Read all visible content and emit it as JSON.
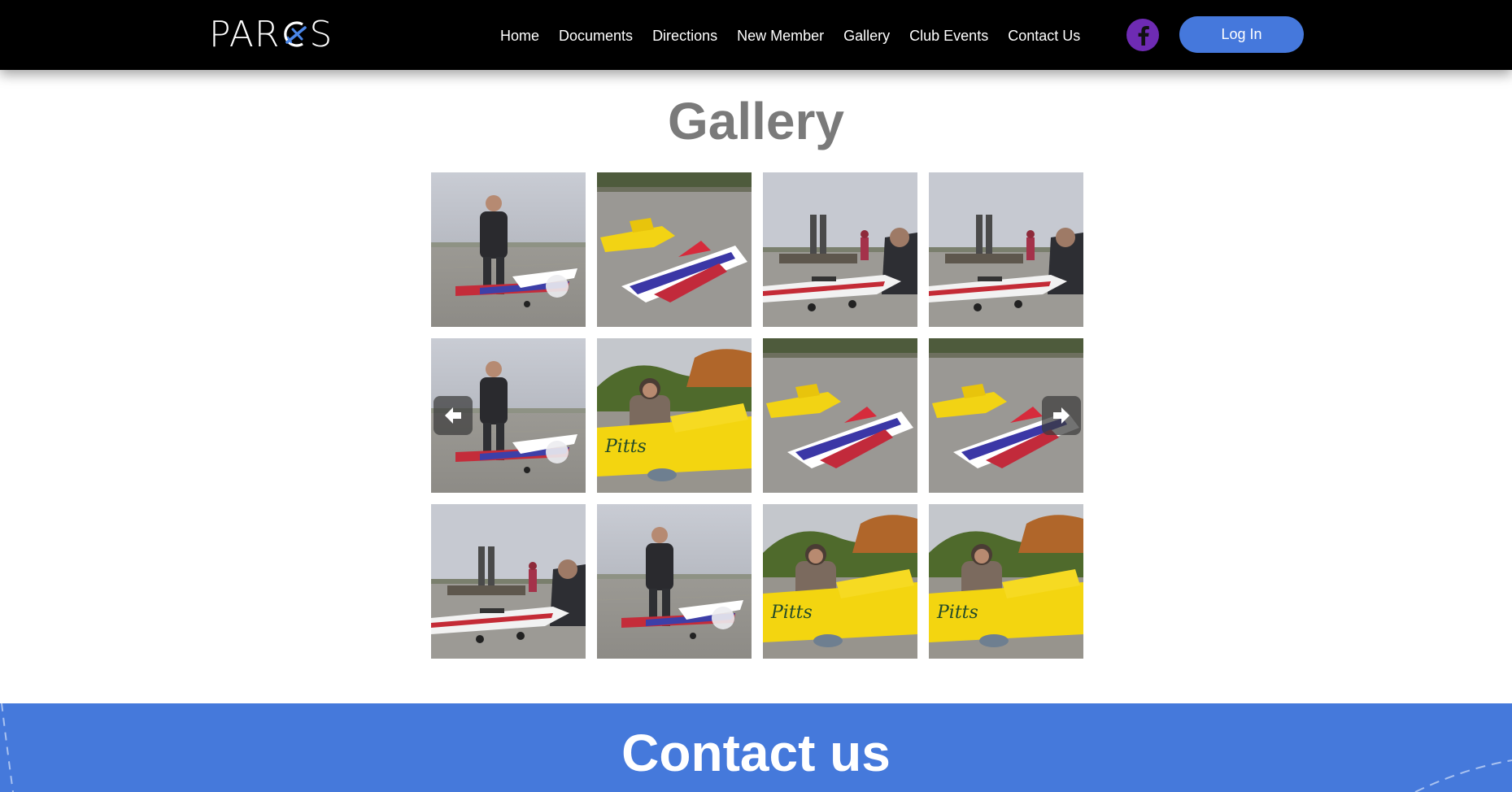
{
  "header": {
    "logo_text_left": "PAR",
    "logo_text_right": "S",
    "nav": [
      "Home",
      "Documents",
      "Directions",
      "New Member",
      "Gallery",
      "Club Events",
      "Contact Us"
    ],
    "social_icon": "facebook-icon",
    "login_label": "Log In"
  },
  "gallery": {
    "title": "Gallery",
    "prev_icon": "arrow-left-icon",
    "next_icon": "arrow-right-icon",
    "rows": 3,
    "columns": 4,
    "images": [
      "man-standing-with-plane",
      "yellow-and-striped-planes",
      "man-with-white-plane-at-tables",
      "man-with-white-plane-at-tables",
      "man-standing-with-plane",
      "man-kneeling-with-yellow-pitts",
      "yellow-and-striped-planes",
      "yellow-and-striped-planes",
      "man-with-white-plane-at-tables",
      "man-standing-with-plane",
      "man-kneeling-with-yellow-pitts",
      "man-kneeling-with-yellow-pitts"
    ]
  },
  "contact": {
    "title": "Contact us"
  },
  "colors": {
    "header_bg": "#000000",
    "accent_blue": "#4579db",
    "facebook_purple": "#6e2bb3",
    "title_gray": "#7a7a7a"
  }
}
